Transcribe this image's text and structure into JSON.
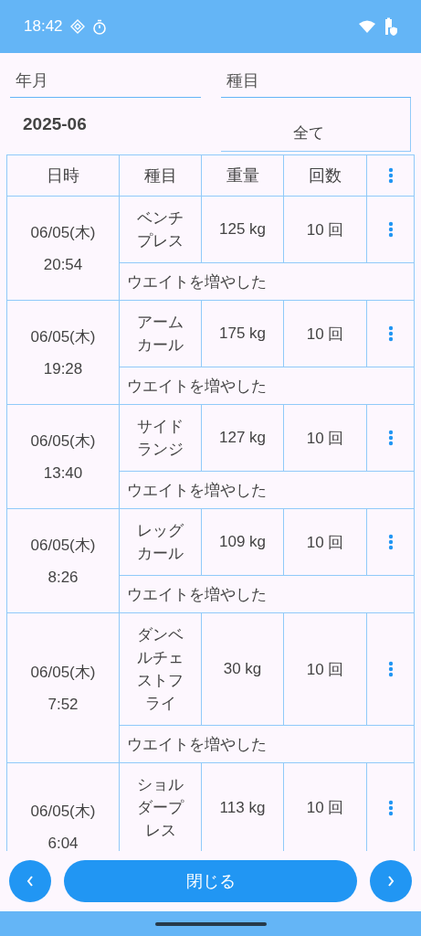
{
  "status_bar": {
    "time": "18:42"
  },
  "filters": [
    {
      "label": "年月",
      "value": "2025-06"
    },
    {
      "label": "種目",
      "value": "全て"
    }
  ],
  "table": {
    "columns": [
      "日時",
      "種目",
      "重量",
      "回数"
    ],
    "rows": [
      {
        "date": "06/05(木)",
        "time": "20:54",
        "exercise": "ベンチプレス",
        "weight": "125 kg",
        "reps": "10 回",
        "note": "ウエイトを増やした"
      },
      {
        "date": "06/05(木)",
        "time": "19:28",
        "exercise": "アームカール",
        "weight": "175 kg",
        "reps": "10 回",
        "note": "ウエイトを増やした"
      },
      {
        "date": "06/05(木)",
        "time": "13:40",
        "exercise": "サイドランジ",
        "weight": "127 kg",
        "reps": "10 回",
        "note": "ウエイトを増やした"
      },
      {
        "date": "06/05(木)",
        "time": "8:26",
        "exercise": "レッグカール",
        "weight": "109 kg",
        "reps": "10 回",
        "note": "ウエイトを増やした"
      },
      {
        "date": "06/05(木)",
        "time": "7:52",
        "exercise": "ダンベルチェストフライ",
        "weight": "30 kg",
        "reps": "10 回",
        "note": "ウエイトを増やした"
      },
      {
        "date": "06/05(木)",
        "time": "6:04",
        "exercise": "ショルダープレス",
        "weight": "113 kg",
        "reps": "10 回"
      }
    ]
  },
  "footer": {
    "close_button": "閉じる"
  }
}
